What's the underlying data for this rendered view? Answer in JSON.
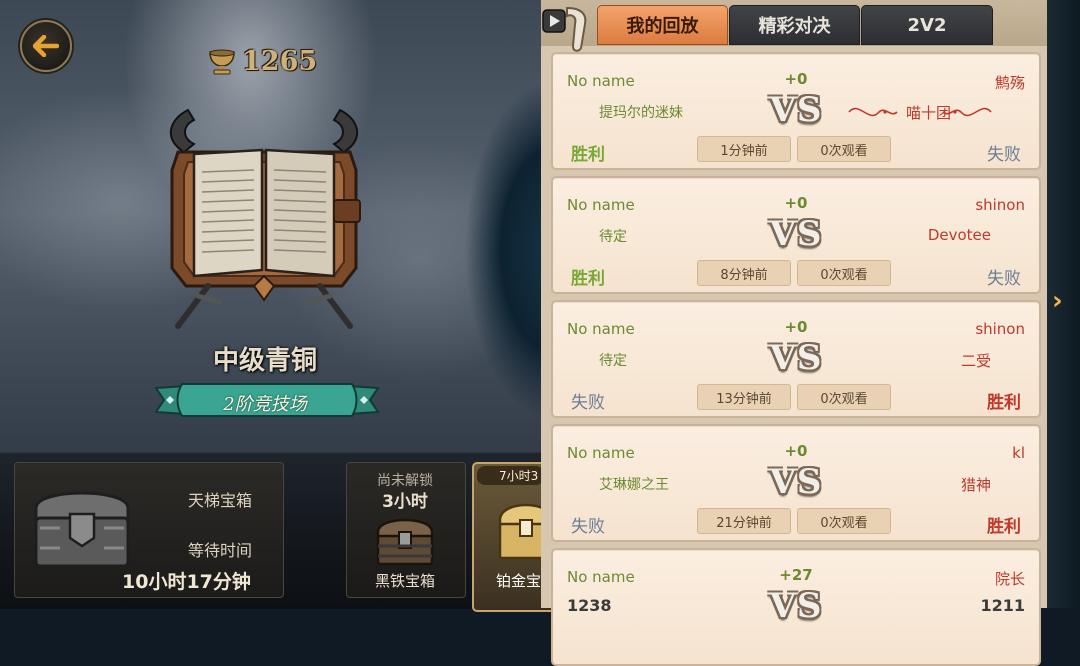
{
  "player": {
    "trophies": "1265",
    "rank_title": "中级青铜",
    "arena_label": "2阶竞技场"
  },
  "chests": {
    "main": {
      "name": "天梯宝箱",
      "wait_label": "等待时间",
      "time": "10小时17分钟"
    },
    "slot2": {
      "lock_label": "尚未解锁",
      "time": "3小时",
      "name": "黑铁宝箱"
    },
    "slot3": {
      "time": "7小时3",
      "name": "铂金宝"
    }
  },
  "tabs": [
    {
      "label": "我的回放",
      "active": true
    },
    {
      "label": "精彩对决",
      "active": false
    },
    {
      "label": "2V2",
      "active": false
    }
  ],
  "vs_label": "VS",
  "replays": [
    {
      "p1": "No name",
      "p1_team": "提玛尔的迷妹",
      "score": "+0",
      "p2": "鹪殇",
      "p2_team": "喵十团",
      "time": "1分钟前",
      "views": "0次观看",
      "left_result": "胜利",
      "right_result": "失败"
    },
    {
      "p1": "No name",
      "p1_team": "待定",
      "score": "+0",
      "p2": "shinon",
      "p2_team": "Devotee",
      "time": "8分钟前",
      "views": "0次观看",
      "left_result": "胜利",
      "right_result": "失败"
    },
    {
      "p1": "No name",
      "p1_team": "待定",
      "score": "+0",
      "p2": "shinon",
      "p2_team": "二受",
      "time": "13分钟前",
      "views": "0次观看",
      "left_result": "失败",
      "right_result": "胜利"
    },
    {
      "p1": "No name",
      "p1_team": "艾琳娜之王",
      "score": "+0",
      "p2": "kl",
      "p2_team": "猎神",
      "time": "21分钟前",
      "views": "0次观看",
      "left_result": "失败",
      "right_result": "胜利"
    },
    {
      "p1": "No name",
      "p1_team": "",
      "score": "+27",
      "p2": "院长",
      "p2_team": "",
      "left_level": "1238",
      "right_level": "1211"
    }
  ],
  "colors": {
    "win_green": "#7da63a",
    "win_red": "#c0392b",
    "lose_blue": "#6b7e95",
    "tab_active": "#e88a4f",
    "tab_inactive": "#383a3d"
  }
}
